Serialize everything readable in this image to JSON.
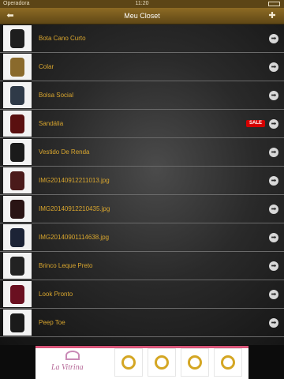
{
  "status_bar": {
    "carrier": "Operadora",
    "time": "11:20"
  },
  "navbar": {
    "title": "Meu Closet",
    "back_icon": "back-arrow-icon",
    "add_icon": "add-closet-icon"
  },
  "items": [
    {
      "label": "Bota Cano Curto",
      "thumb_color": "#1e1e1e",
      "sale": ""
    },
    {
      "label": "Colar",
      "thumb_color": "#8a6a2c",
      "sale": ""
    },
    {
      "label": "Bolsa Social",
      "thumb_color": "#2f3a48",
      "sale": ""
    },
    {
      "label": "Sandália",
      "thumb_color": "#5a1010",
      "sale": "SALE"
    },
    {
      "label": "Vestido De Renda",
      "thumb_color": "#1a1a1a",
      "sale": ""
    },
    {
      "label": "IMG20140912211013.jpg",
      "thumb_color": "#4a1a1a",
      "sale": ""
    },
    {
      "label": "IMG20140912210435.jpg",
      "thumb_color": "#2a1414",
      "sale": ""
    },
    {
      "label": "IMG20140901114638.jpg",
      "thumb_color": "#1c2336",
      "sale": ""
    },
    {
      "label": "Brinco Leque Preto",
      "thumb_color": "#222222",
      "sale": ""
    },
    {
      "label": "Look Pronto",
      "thumb_color": "#6a1020",
      "sale": ""
    },
    {
      "label": "Peep Toe",
      "thumb_color": "#1a1a1a",
      "sale": ""
    }
  ],
  "ad": {
    "brand": "La Vitrina"
  },
  "colors": {
    "accent": "#d9a62e",
    "nav": "#7a5c1e",
    "sale": "#d40000"
  }
}
